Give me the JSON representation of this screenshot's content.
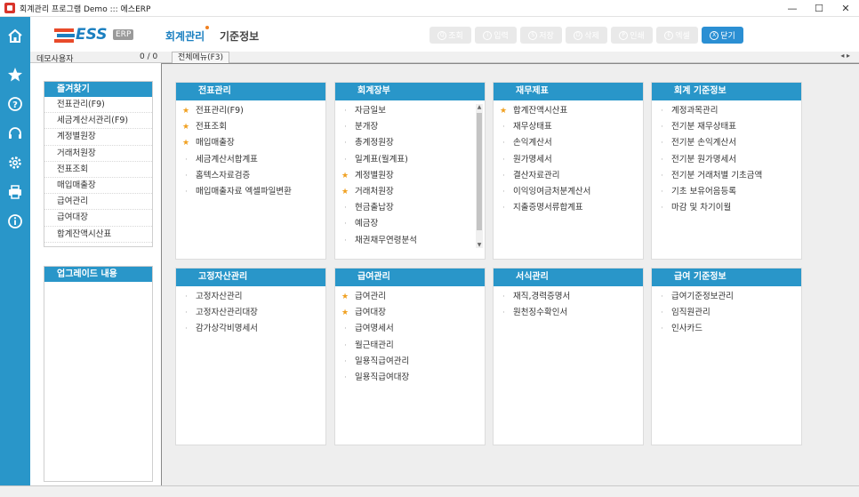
{
  "window": {
    "title": "회계관리 프로그램 Demo ::: 에스ERP",
    "minimize": "—",
    "maximize": "☐",
    "close": "✕"
  },
  "logo": {
    "text": "ESS",
    "badge": "ERP"
  },
  "nav": {
    "main": "회계관리",
    "sub": "기준정보"
  },
  "toolbar": [
    {
      "icon": "Q",
      "label": "조회"
    },
    {
      "icon": "i",
      "label": "입력"
    },
    {
      "icon": "S",
      "label": "저장"
    },
    {
      "icon": "D",
      "label": "삭제"
    },
    {
      "icon": "P",
      "label": "인쇄"
    },
    {
      "icon": "E",
      "label": "엑셀"
    },
    {
      "icon": "X",
      "label": "닫기"
    }
  ],
  "tabstrip": {
    "user": "데모사용자",
    "count": "0 / 0",
    "tab": "전체메뉴(F3)",
    "nav": "◂ ▸"
  },
  "favorites": {
    "title": "즐겨찾기",
    "items": [
      "전표관리(F9)",
      "세금계산서관리(F9)",
      "계정별원장",
      "거래처원장",
      "전표조회",
      "매입매출장",
      "급여관리",
      "급여대장",
      "합계잔액시산표"
    ]
  },
  "upgrade": {
    "title": "업그레이드 내용"
  },
  "menus": [
    {
      "title": "전표관리",
      "items": [
        {
          "label": "전표관리(F9)",
          "star": true
        },
        {
          "label": "전표조회",
          "star": true
        },
        {
          "label": "매입매출장",
          "star": true
        },
        {
          "label": "세금계산서합계표",
          "star": false
        },
        {
          "label": "홈텍스자료검증",
          "star": false
        },
        {
          "label": "매입매출자료 엑셀파일변환",
          "star": false
        }
      ]
    },
    {
      "title": "회계장부",
      "items": [
        {
          "label": "자금일보",
          "star": false
        },
        {
          "label": "분개장",
          "star": false
        },
        {
          "label": "총계정원장",
          "star": false
        },
        {
          "label": "일계표(월계표)",
          "star": false
        },
        {
          "label": "계정별원장",
          "star": true
        },
        {
          "label": "거래처원장",
          "star": true
        },
        {
          "label": "현금출납장",
          "star": false
        },
        {
          "label": "예금장",
          "star": false
        },
        {
          "label": "채권채무연령분석",
          "star": false
        }
      ]
    },
    {
      "title": "재무제표",
      "items": [
        {
          "label": "합계잔액시산표",
          "star": true
        },
        {
          "label": "재무상태표",
          "star": false
        },
        {
          "label": "손익계산서",
          "star": false
        },
        {
          "label": "원가명세서",
          "star": false
        },
        {
          "label": "결산자료관리",
          "star": false
        },
        {
          "label": "이익잉여금처분계산서",
          "star": false
        },
        {
          "label": "지출증명서류합계표",
          "star": false
        }
      ]
    },
    {
      "title": "회계 기준정보",
      "items": [
        {
          "label": "계정과목관리",
          "star": false
        },
        {
          "label": "전기분 재무상태표",
          "star": false
        },
        {
          "label": "전기분 손익계산서",
          "star": false
        },
        {
          "label": "전기분 원가명세서",
          "star": false
        },
        {
          "label": "전기분 거래처별 기초금액",
          "star": false
        },
        {
          "label": "기초 보유어음등록",
          "star": false
        },
        {
          "label": "마감 및 차기이월",
          "star": false
        }
      ]
    },
    {
      "title": "고정자산관리",
      "items": [
        {
          "label": "고정자산관리",
          "star": false
        },
        {
          "label": "고정자산관리대장",
          "star": false
        },
        {
          "label": "감가상각비명세서",
          "star": false
        }
      ]
    },
    {
      "title": "급여관리",
      "items": [
        {
          "label": "급여관리",
          "star": true
        },
        {
          "label": "급여대장",
          "star": true
        },
        {
          "label": "급여명세서",
          "star": false
        },
        {
          "label": "월근태관리",
          "star": false
        },
        {
          "label": "일용직급여관리",
          "star": false
        },
        {
          "label": "일용직급여대장",
          "star": false
        }
      ]
    },
    {
      "title": "서식관리",
      "items": [
        {
          "label": "재직,경력증명서",
          "star": false
        },
        {
          "label": "원천징수확인서",
          "star": false
        }
      ]
    },
    {
      "title": "급여 기준정보",
      "items": [
        {
          "label": "급여기준정보관리",
          "star": false
        },
        {
          "label": "임직원관리",
          "star": false
        },
        {
          "label": "인사카드",
          "star": false
        }
      ]
    }
  ],
  "colors": {
    "accent": "#2996c9",
    "star": "#f0a020",
    "close_button": "#2b8fd3"
  },
  "rail_icons": [
    "home-icon",
    "star-icon",
    "help-icon",
    "headset-icon",
    "settings-icon",
    "printer-settings-icon",
    "info-icon"
  ]
}
